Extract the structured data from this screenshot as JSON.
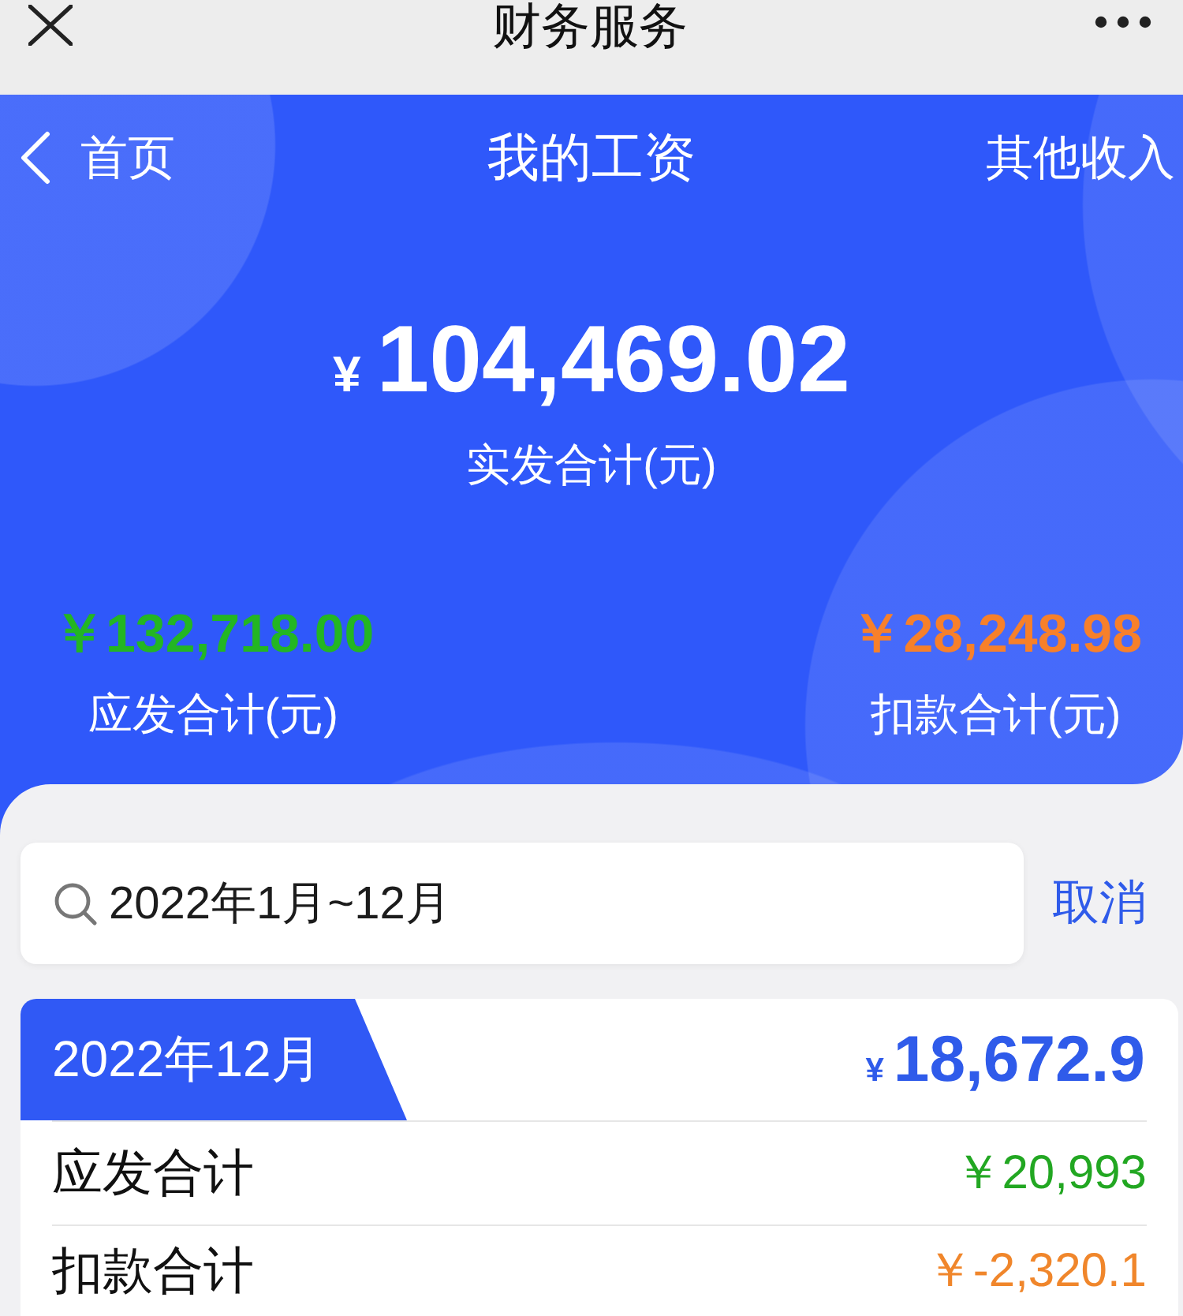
{
  "top_bar": {
    "title": "财务服务"
  },
  "nav": {
    "back": "首页",
    "title": "我的工资",
    "action": "其他收入"
  },
  "summary": {
    "currency": "¥",
    "net_total": "104,469.02",
    "net_label": "实发合计(元)",
    "stats": [
      {
        "amount": "￥132,718.00",
        "label": "应发合计(元)",
        "color": "#23b623"
      },
      {
        "amount": "￥28,248.98",
        "label": "扣款合计(元)",
        "color": "#f7802a"
      }
    ]
  },
  "search": {
    "value": "2022年1月~12月",
    "cancel": "取消"
  },
  "months": [
    {
      "month": "2022年12月",
      "currency": "¥",
      "net": "18,672.9",
      "rows": [
        {
          "label": "应发合计",
          "amount": "￥20,993",
          "color": "#22a722"
        },
        {
          "label": "扣款合计",
          "amount": "￥-2,320.1",
          "color": "#f0862b"
        }
      ]
    }
  ]
}
